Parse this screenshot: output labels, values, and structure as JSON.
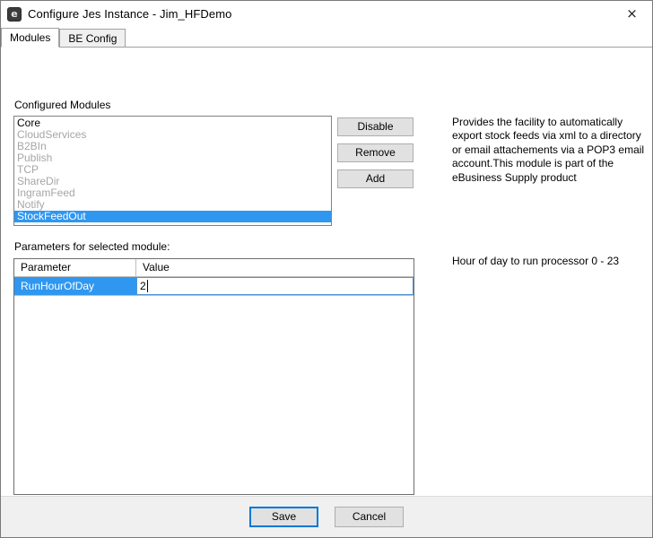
{
  "window": {
    "title": "Configure Jes Instance - Jim_HFDemo",
    "app_icon": "jes-app-icon",
    "close_label": "×"
  },
  "tabs": [
    {
      "label": "Modules",
      "active": true
    },
    {
      "label": "BE Config",
      "active": false
    }
  ],
  "modules_section": {
    "label": "Configured Modules",
    "items": [
      {
        "name": "Core",
        "state": "enabled",
        "selected": false
      },
      {
        "name": "CloudServices",
        "state": "disabled",
        "selected": false
      },
      {
        "name": "B2BIn",
        "state": "disabled",
        "selected": false
      },
      {
        "name": "Publish",
        "state": "disabled",
        "selected": false
      },
      {
        "name": "TCP",
        "state": "disabled",
        "selected": false
      },
      {
        "name": "ShareDir",
        "state": "disabled",
        "selected": false
      },
      {
        "name": "IngramFeed",
        "state": "disabled",
        "selected": false
      },
      {
        "name": "Notify",
        "state": "disabled",
        "selected": false
      },
      {
        "name": "StockFeedOut",
        "state": "enabled",
        "selected": true
      }
    ],
    "buttons": {
      "disable": "Disable",
      "remove": "Remove",
      "add": "Add"
    },
    "description": "Provides the facility to automatically export stock feeds via xml to a directory or email attachements via a POP3 email account.This module is part of the eBusiness Supply product"
  },
  "parameters_section": {
    "label": "Parameters for selected module:",
    "columns": [
      "Parameter",
      "Value"
    ],
    "rows": [
      {
        "parameter": "RunHourOfDay",
        "value": "2",
        "selected": true,
        "editing": true
      }
    ],
    "description": "Hour of day to run processor 0 - 23"
  },
  "footer": {
    "save_label": "Save",
    "cancel_label": "Cancel"
  },
  "colors": {
    "selection_blue": "#2f97f0",
    "focus_blue": "#0078d7",
    "disabled_text": "#a6a6a6",
    "button_face": "#e1e1e1",
    "footer_bg": "#f0f0f0"
  }
}
